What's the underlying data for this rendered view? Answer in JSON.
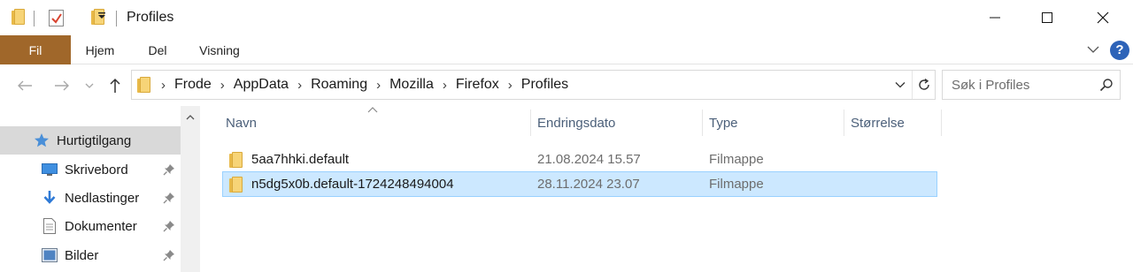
{
  "window": {
    "title": "Profiles"
  },
  "ribbon": {
    "tabs": [
      {
        "label": "Fil"
      },
      {
        "label": "Hjem"
      },
      {
        "label": "Del"
      },
      {
        "label": "Visning"
      }
    ],
    "help_label": "?"
  },
  "address": {
    "breadcrumbs": [
      "Frode",
      "AppData",
      "Roaming",
      "Mozilla",
      "Firefox",
      "Profiles"
    ]
  },
  "search": {
    "placeholder": "Søk i Profiles"
  },
  "nav": {
    "items": [
      {
        "label": "Hurtigtilgang",
        "icon": "star-icon",
        "selected": true
      },
      {
        "label": "Skrivebord",
        "icon": "desktop-icon",
        "pinned": true
      },
      {
        "label": "Nedlastinger",
        "icon": "download-icon",
        "pinned": true
      },
      {
        "label": "Dokumenter",
        "icon": "document-icon",
        "pinned": true
      },
      {
        "label": "Bilder",
        "icon": "pictures-icon",
        "pinned": true
      }
    ]
  },
  "filelist": {
    "columns": [
      {
        "label": "Navn"
      },
      {
        "label": "Endringsdato"
      },
      {
        "label": "Type"
      },
      {
        "label": "Størrelse"
      }
    ],
    "rows": [
      {
        "name": "5aa7hhki.default",
        "date": "21.08.2024 15.57",
        "type": "Filmappe",
        "size": "",
        "selected": false
      },
      {
        "name": "n5dg5x0b.default-1724248494004",
        "date": "28.11.2024 23.07",
        "type": "Filmappe",
        "size": "",
        "selected": true
      }
    ]
  },
  "colors": {
    "file_tab": "#a0672a",
    "selection_bg": "#cce8ff",
    "selection_border": "#99d1ff",
    "header_text": "#4c607a",
    "help_blue": "#2d63b8",
    "folder_yellow": "#f7d477"
  }
}
